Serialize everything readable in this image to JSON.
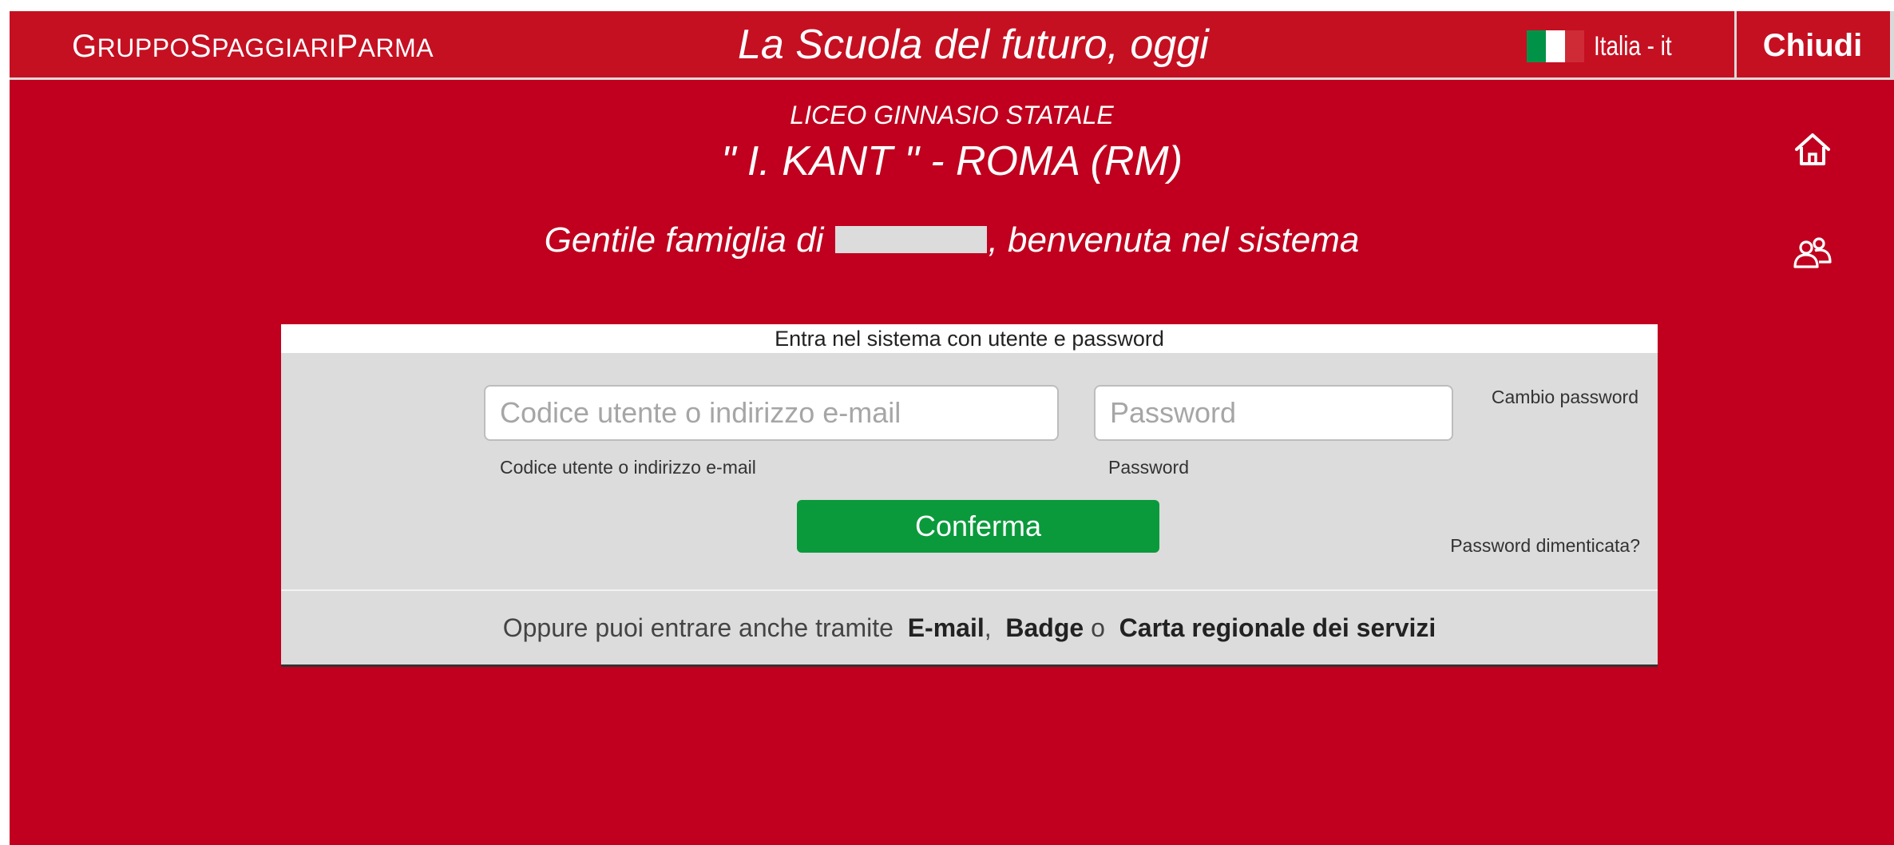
{
  "header": {
    "brand_parts": [
      {
        "cap": "G",
        "rest": "ruppo"
      },
      {
        "cap": "S",
        "rest": "paggiari"
      },
      {
        "cap": "P",
        "rest": "arma"
      }
    ],
    "slogan": "La Scuola del futuro, oggi",
    "language_label": "Italia - it",
    "close_label": "Chiudi",
    "flag_colors": [
      "#009246",
      "#ffffff",
      "#ce2b37"
    ]
  },
  "school": {
    "type": "LICEO GINNASIO STATALE",
    "name": "\" I. KANT \" - ROMA (RM)"
  },
  "welcome": {
    "prefix": "Gentile famiglia di ",
    "suffix": ", benvenuta nel sistema"
  },
  "side_icons": [
    "home-icon",
    "users-icon"
  ],
  "login": {
    "heading": "Entra nel sistema con utente e password",
    "user_placeholder": "Codice utente o indirizzo e-mail",
    "user_label": "Codice utente o indirizzo e-mail",
    "password_placeholder": "Password",
    "password_label": "Password",
    "change_password": "Cambio password",
    "confirm": "Conferma",
    "forgot_password": "Password dimenticata?",
    "alt_prefix": "Oppure puoi entrare anche tramite",
    "alt_email": "E-mail",
    "comma": ",",
    "alt_badge": "Badge",
    "alt_or": "o",
    "alt_card": "Carta regionale dei servizi"
  },
  "colors": {
    "background": "#c0001e",
    "confirm_button": "#0a9a3b",
    "panel": "#dcdcdc"
  }
}
